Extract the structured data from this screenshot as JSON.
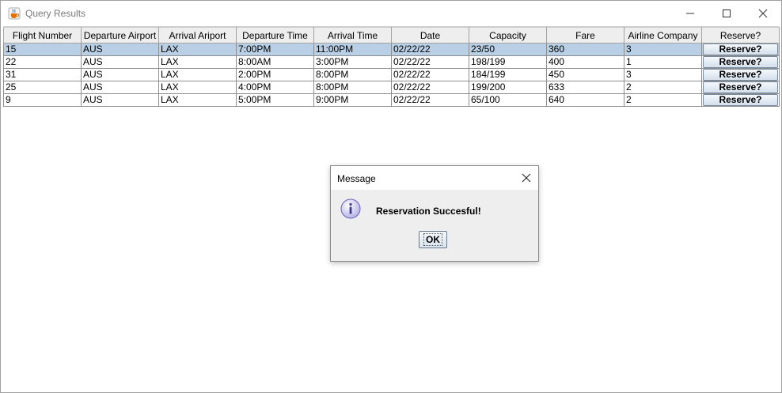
{
  "window": {
    "title": "Query Results",
    "icon": "java-coffee-icon",
    "controls": [
      "minimize-icon",
      "maximize-icon",
      "close-icon"
    ]
  },
  "table": {
    "columns": [
      "Flight Number",
      "Departure Airport",
      "Arrival Ariport",
      "Departure Time",
      "Arrival Time",
      "Date",
      "Capacity",
      "Fare",
      "Airline Company",
      "Reserve?"
    ],
    "rows": [
      {
        "flight": "15",
        "dep": "AUS",
        "arr": "LAX",
        "dep_time": "7:00PM",
        "arr_time": "11:00PM",
        "date": "02/22/22",
        "capacity": "23/50",
        "fare": "360",
        "airline": "3",
        "action": "Reserve?"
      },
      {
        "flight": "22",
        "dep": "AUS",
        "arr": "LAX",
        "dep_time": "8:00AM",
        "arr_time": "3:00PM",
        "date": "02/22/22",
        "capacity": "198/199",
        "fare": "400",
        "airline": "1",
        "action": "Reserve?"
      },
      {
        "flight": "31",
        "dep": "AUS",
        "arr": "LAX",
        "dep_time": "2:00PM",
        "arr_time": "8:00PM",
        "date": "02/22/22",
        "capacity": "184/199",
        "fare": "450",
        "airline": "3",
        "action": "Reserve?"
      },
      {
        "flight": "25",
        "dep": "AUS",
        "arr": "LAX",
        "dep_time": "4:00PM",
        "arr_time": "8:00PM",
        "date": "02/22/22",
        "capacity": "199/200",
        "fare": "633",
        "airline": "2",
        "action": "Reserve?"
      },
      {
        "flight": "9",
        "dep": "AUS",
        "arr": "LAX",
        "dep_time": "5:00PM",
        "arr_time": "9:00PM",
        "date": "02/22/22",
        "capacity": "65/100",
        "fare": "640",
        "airline": "2",
        "action": "Reserve?"
      }
    ],
    "selected_row_index": 0,
    "selection_color": "#b8cfe5"
  },
  "dialog": {
    "title": "Message",
    "icon": "info-icon",
    "message": "Reservation Succesful!",
    "ok_label": "OK"
  }
}
